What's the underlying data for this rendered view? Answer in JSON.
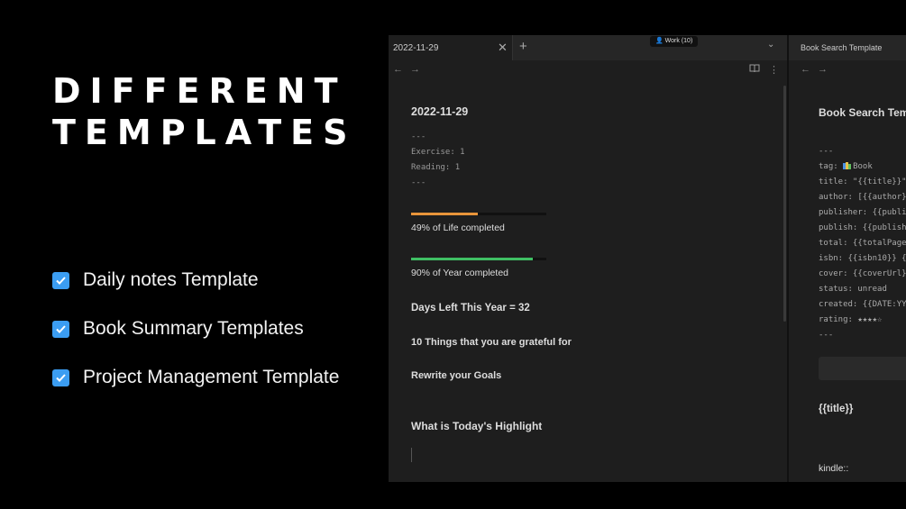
{
  "heading": {
    "line1": "DIFFERENT",
    "line2": "TEMPLATES"
  },
  "checklist": [
    {
      "label": "Daily notes Template"
    },
    {
      "label": "Book Summary Templates"
    },
    {
      "label": "Project Management Template"
    }
  ],
  "colors": {
    "checkbox": "#3b9df2",
    "life_bar": "#e8943a",
    "year_bar": "#3fbf63"
  },
  "left_pane": {
    "tab_label": "2022-11-29",
    "workspace": "Work (10)",
    "note_title": "2022-11-29",
    "frontmatter": [
      "---",
      "Exercise: 1",
      "Reading: 1",
      "---"
    ],
    "life_progress": {
      "value": 0.49,
      "text": "49% of Life completed"
    },
    "year_progress": {
      "value": 0.9,
      "text": "90% of Year completed"
    },
    "days_left": "Days Left This Year = 32",
    "grateful": "10 Things that you are grateful for",
    "goals": "Rewrite your Goals",
    "highlight": "What is Today's Highlight"
  },
  "right_pane": {
    "tab_label": "Book Search Template",
    "note_title": "Book Search Temp",
    "lines": [
      "---",
      "tag: Book",
      "title: \"{{title}}\"",
      "author: [{{author}",
      "publisher: {{publi",
      "publish: {{publish",
      "total: {{totalPage",
      "isbn: {{isbn10}} {",
      "cover: {{coverUrl}",
      "status: unread",
      "created: {{DATE:YY",
      "rating: ★★★★☆",
      "---"
    ],
    "title_placeholder": "{{title}}",
    "kindle": "kindle::"
  }
}
